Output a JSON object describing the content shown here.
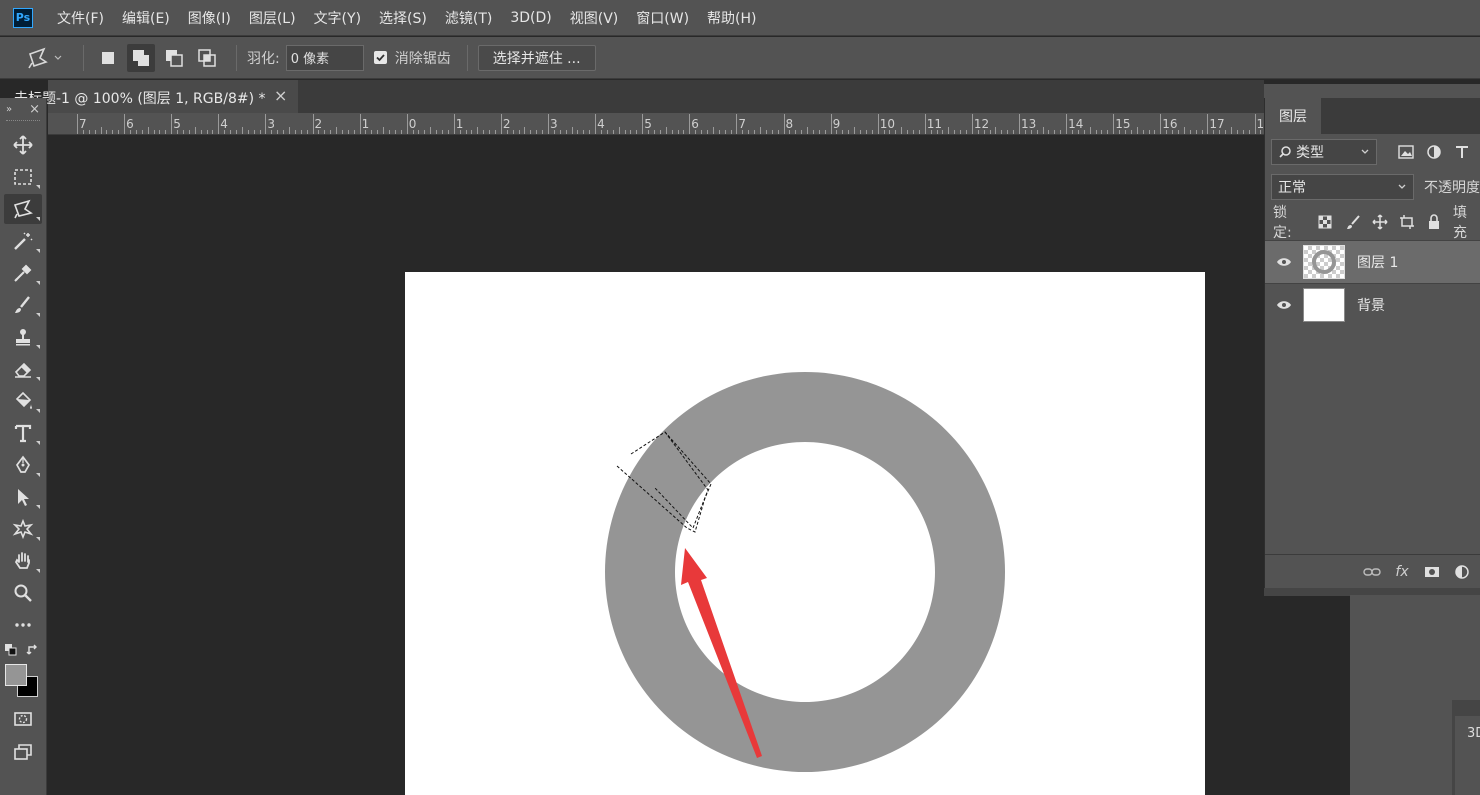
{
  "app": {
    "logo": "Ps"
  },
  "menu": [
    "文件(F)",
    "编辑(E)",
    "图像(I)",
    "图层(L)",
    "文字(Y)",
    "选择(S)",
    "滤镜(T)",
    "3D(D)",
    "视图(V)",
    "窗口(W)",
    "帮助(H)"
  ],
  "options": {
    "feather_label": "羽化:",
    "feather_value": "0 像素",
    "antialias_label": "消除锯齿",
    "antialias_checked": true,
    "select_mask_label": "选择并遮住 ..."
  },
  "document_tab": {
    "title": "未标题-1 @ 100% (图层 1, RGB/8#) *",
    "close": "×"
  },
  "toolbar_head": {
    "collapse": "»",
    "close": "×"
  },
  "ruler": {
    "labels": [
      "7",
      "6",
      "5",
      "4",
      "3",
      "2",
      "1",
      "0",
      "1",
      "2",
      "3",
      "4",
      "5",
      "6",
      "7",
      "8",
      "9",
      "10",
      "11",
      "12",
      "13",
      "14",
      "15",
      "16",
      "17",
      "1"
    ]
  },
  "colors": {
    "ring": "#959595",
    "arrow": "#e8393a",
    "foreground": "#959595",
    "background": "#000000"
  },
  "layers_panel": {
    "tab": "图层",
    "filter_kind": "类型",
    "blend_mode": "正常",
    "opacity_label": "不透明度",
    "lock_label": "锁定:",
    "fill_label": "填充",
    "layers": [
      {
        "name": "图层 1",
        "visible": true,
        "selected": true
      },
      {
        "name": "背景",
        "visible": true,
        "selected": false
      }
    ],
    "footer": {
      "fx": "fx"
    }
  },
  "lower_panel": {
    "label": "3D"
  }
}
